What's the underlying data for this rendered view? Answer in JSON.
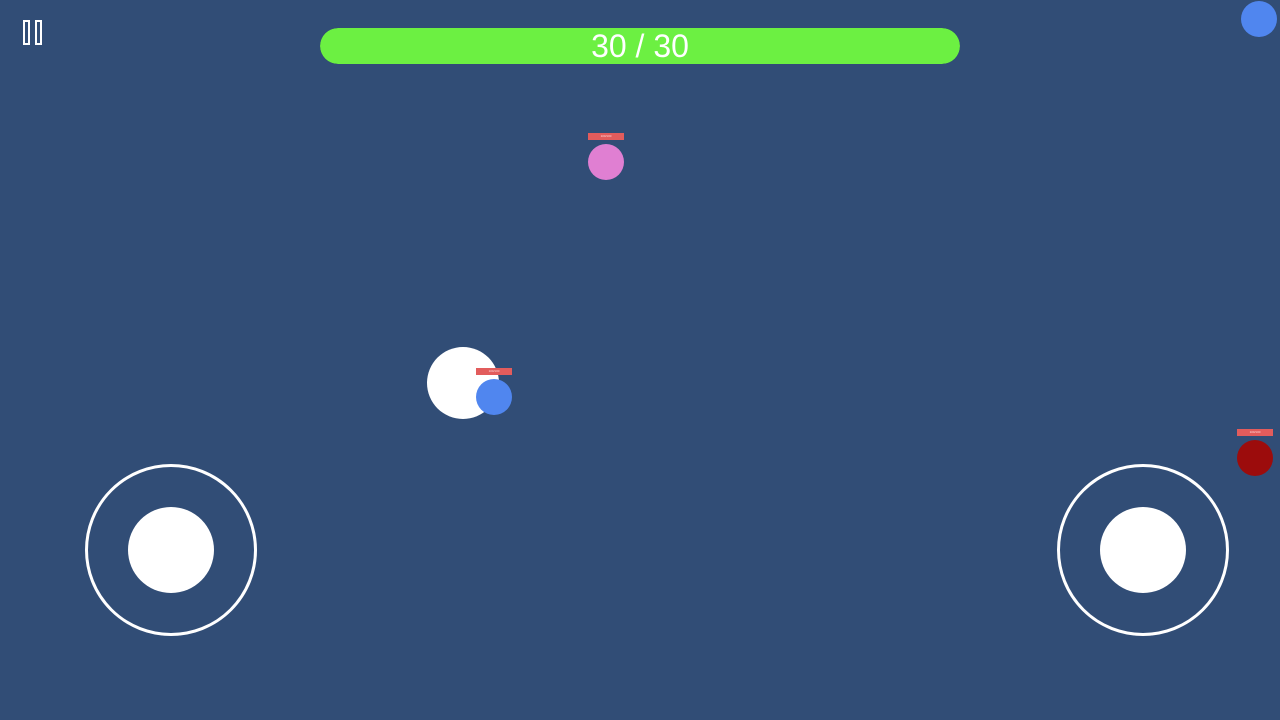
{
  "colors": {
    "background": "#314d76",
    "health_fill": "#6cf042",
    "hp_bar": "#e25c5c",
    "player": "#5086ef",
    "enemy_pink": "#e07fd2",
    "enemy_red": "#9c0c0c",
    "white": "#ffffff"
  },
  "hud": {
    "pause_icon": "pause-icon",
    "health": {
      "current": 30,
      "max": 30,
      "text": "30 / 30",
      "fill_fraction": 1.0
    },
    "corner_indicator": {
      "color": "#5086ef"
    }
  },
  "entities": [
    {
      "name": "enemy-pink",
      "color": "#e07fd2",
      "hp_label": "100/100",
      "hp_fraction": 1.0
    },
    {
      "name": "player",
      "color": "#5086ef",
      "hp_label": "100/100",
      "hp_fraction": 1.0
    },
    {
      "name": "enemy-red",
      "color": "#9c0c0c",
      "hp_label": "100/100",
      "hp_fraction": 1.0
    }
  ],
  "controls": {
    "move_joystick": "move-joystick",
    "aim_joystick": "aim-joystick"
  }
}
